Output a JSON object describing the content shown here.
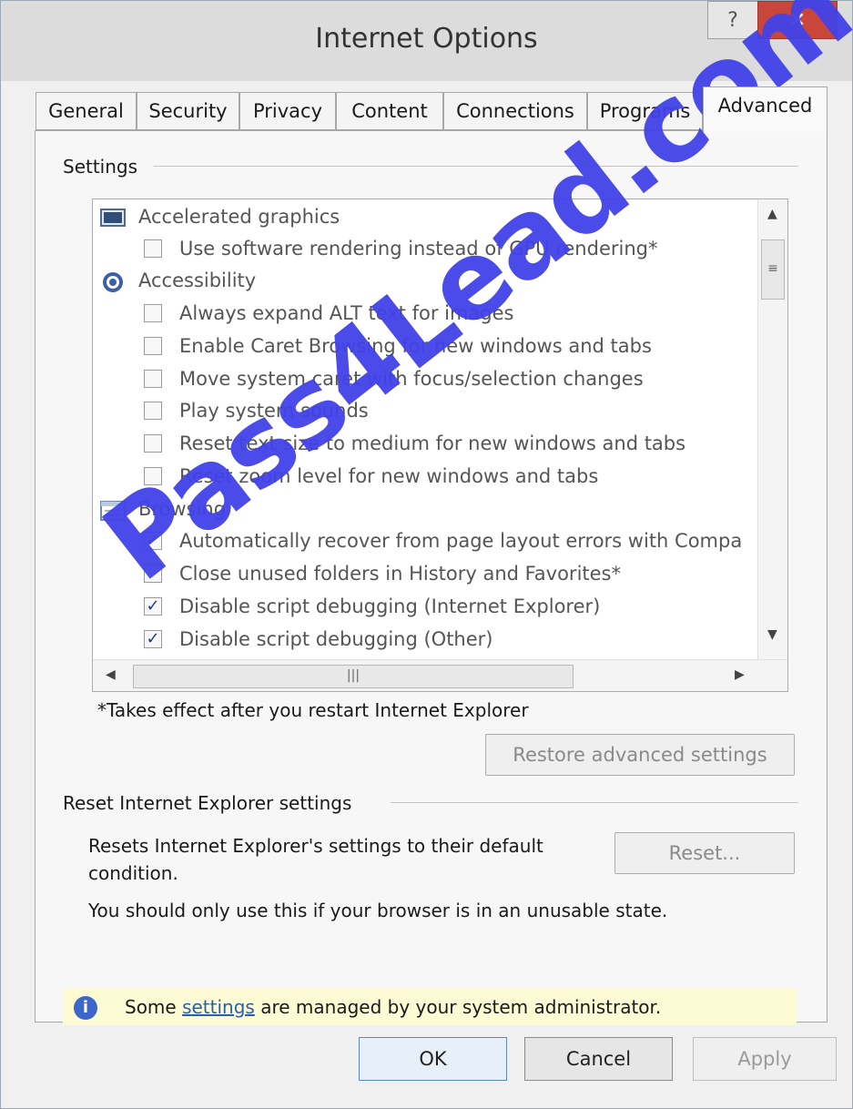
{
  "window": {
    "title": "Internet Options"
  },
  "titlebar": {
    "help_glyph": "?",
    "close_glyph": "✕"
  },
  "tabs": [
    {
      "label": "General"
    },
    {
      "label": "Security"
    },
    {
      "label": "Privacy"
    },
    {
      "label": "Content"
    },
    {
      "label": "Connections"
    },
    {
      "label": "Programs"
    },
    {
      "label": "Advanced",
      "active": true
    }
  ],
  "settings": {
    "group_label": "Settings",
    "rows": [
      {
        "type": "category",
        "label": "Accelerated graphics",
        "icon": "monitor-icon"
      },
      {
        "type": "option",
        "label": "Use software rendering instead of GPU rendering*",
        "checked": false
      },
      {
        "type": "category",
        "label": "Accessibility",
        "icon": "accessibility-icon"
      },
      {
        "type": "option",
        "label": "Always expand ALT text for images",
        "checked": false
      },
      {
        "type": "option",
        "label": "Enable Caret Browsing for new windows and tabs",
        "checked": false
      },
      {
        "type": "option",
        "label": "Move system caret with focus/selection changes",
        "checked": false
      },
      {
        "type": "option",
        "label": "Play system sounds",
        "checked": false
      },
      {
        "type": "option",
        "label": "Reset text size to medium for new windows and tabs",
        "checked": false
      },
      {
        "type": "option",
        "label": "Reset zoom level for new windows and tabs",
        "checked": false
      },
      {
        "type": "category",
        "label": "Browsing",
        "icon": "browsing-icon"
      },
      {
        "type": "option",
        "label": "Automatically recover from page layout errors with Compa",
        "checked": true
      },
      {
        "type": "option",
        "label": "Close unused folders in History and Favorites*",
        "checked": false
      },
      {
        "type": "option",
        "label": "Disable script debugging (Internet Explorer)",
        "checked": true
      },
      {
        "type": "option",
        "label": "Disable script debugging (Other)",
        "checked": true
      }
    ],
    "note": "*Takes effect after you restart Internet Explorer",
    "restore_button": "Restore advanced settings"
  },
  "reset": {
    "group_label": "Reset Internet Explorer settings",
    "description": "Resets Internet Explorer's settings to their default condition.",
    "button": "Reset...",
    "warning": "You should only use this if your browser is in an unusable state."
  },
  "info_bar": {
    "prefix": "Some ",
    "link": "settings",
    "suffix": " are managed by your system administrator."
  },
  "buttons": {
    "ok": "OK",
    "cancel": "Cancel",
    "apply": "Apply"
  },
  "watermark": "Pass4Lead.com"
}
